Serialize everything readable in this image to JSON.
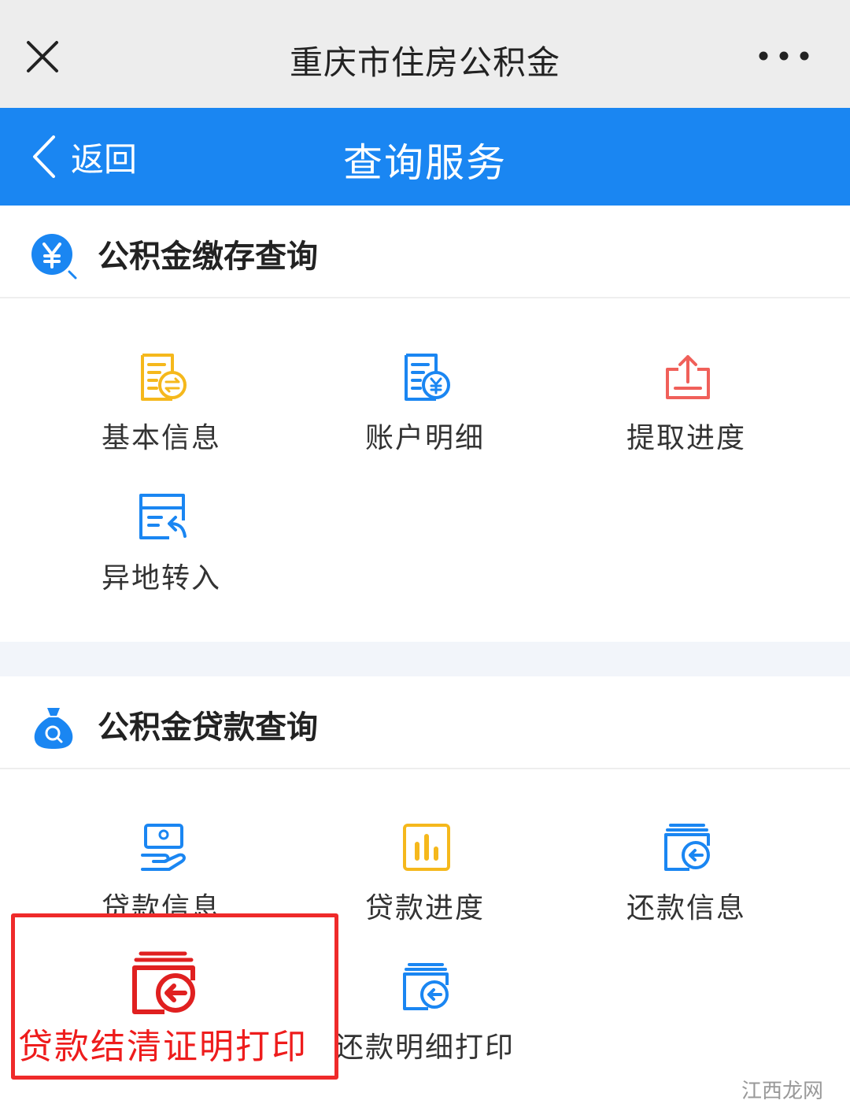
{
  "wechat_bar": {
    "title": "重庆市住房公积金"
  },
  "header": {
    "back_label": "返回",
    "title": "查询服务",
    "color": "#1a86f2"
  },
  "sections": [
    {
      "title": "公积金缴存查询",
      "items": [
        {
          "label": "基本信息",
          "icon": "document-exchange-icon"
        },
        {
          "label": "账户明细",
          "icon": "document-yuan-icon"
        },
        {
          "label": "提取进度",
          "icon": "upload-tray-icon"
        },
        {
          "label": "异地转入",
          "icon": "card-transfer-icon"
        }
      ]
    },
    {
      "title": "公积金贷款查询",
      "items": [
        {
          "label": "贷款信息",
          "icon": "hand-card-icon"
        },
        {
          "label": "贷款进度",
          "icon": "bar-chart-icon"
        },
        {
          "label": "还款信息",
          "icon": "return-arrow-icon"
        },
        {
          "label": "贷款结清证明打印",
          "icon": "return-arrow-icon"
        },
        {
          "label": "还款明细打印",
          "icon": "return-arrow-icon"
        }
      ]
    }
  ],
  "watermark": "江西龙网"
}
